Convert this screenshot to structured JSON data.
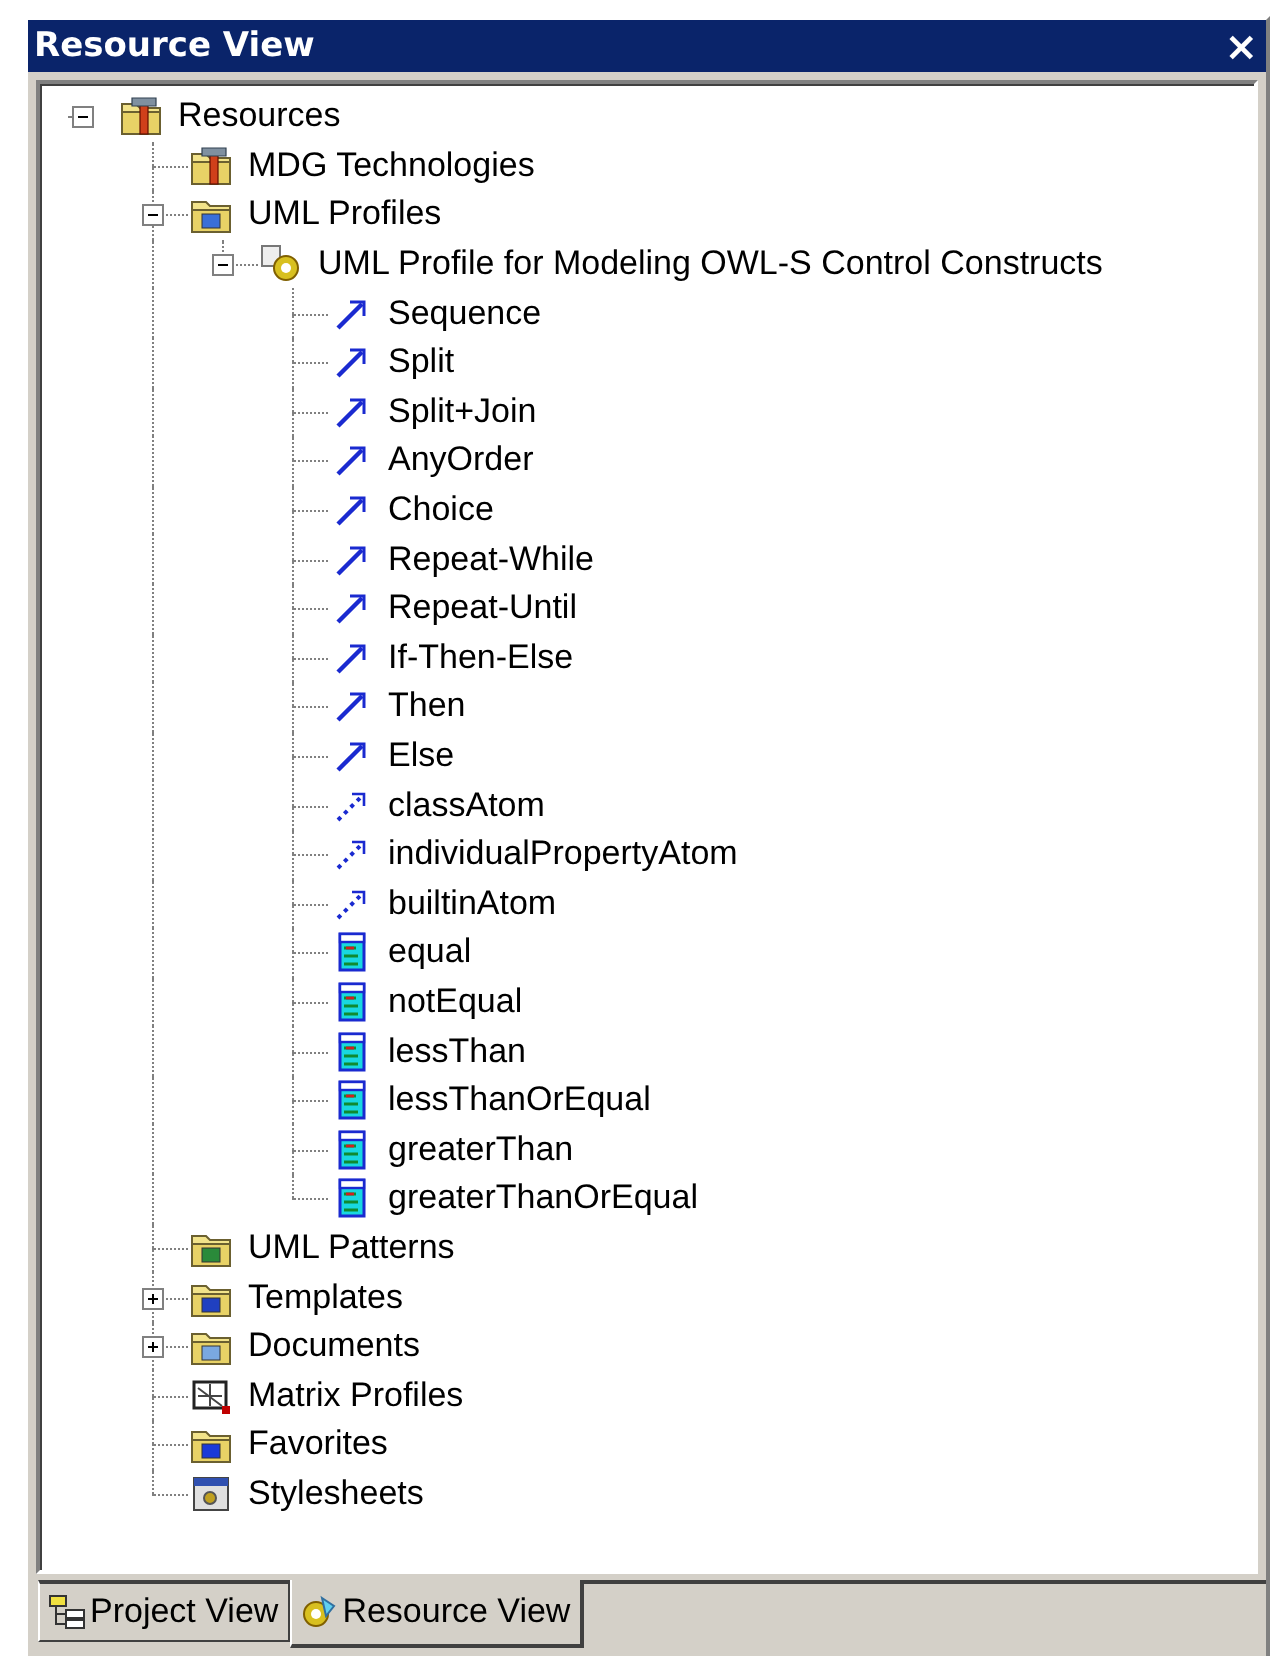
{
  "window": {
    "title": "Resource View",
    "close": "×"
  },
  "tree": [
    {
      "label": "Resources",
      "kind": "folder-tools",
      "expanded": true,
      "children": [
        {
          "label": "MDG Technologies",
          "kind": "folder-tools"
        },
        {
          "label": "UML Profiles",
          "kind": "folder-profiles",
          "expanded": true,
          "children": [
            {
              "label": "UML Profile for Modeling OWL-S Control Constructs",
              "kind": "profile",
              "expanded": true,
              "children": [
                {
                  "label": "Sequence",
                  "kind": "stereotype"
                },
                {
                  "label": "Split",
                  "kind": "stereotype"
                },
                {
                  "label": "Split+Join",
                  "kind": "stereotype"
                },
                {
                  "label": "AnyOrder",
                  "kind": "stereotype"
                },
                {
                  "label": "Choice",
                  "kind": "stereotype"
                },
                {
                  "label": "Repeat-While",
                  "kind": "stereotype"
                },
                {
                  "label": "Repeat-Until",
                  "kind": "stereotype"
                },
                {
                  "label": "If-Then-Else",
                  "kind": "stereotype"
                },
                {
                  "label": "Then",
                  "kind": "stereotype"
                },
                {
                  "label": "Else",
                  "kind": "stereotype"
                },
                {
                  "label": "classAtom",
                  "kind": "dependency"
                },
                {
                  "label": "individualPropertyAtom",
                  "kind": "dependency"
                },
                {
                  "label": "builtinAtom",
                  "kind": "dependency"
                },
                {
                  "label": "equal",
                  "kind": "table"
                },
                {
                  "label": "notEqual",
                  "kind": "table"
                },
                {
                  "label": "lessThan",
                  "kind": "table"
                },
                {
                  "label": "lessThanOrEqual",
                  "kind": "table"
                },
                {
                  "label": "greaterThan",
                  "kind": "table"
                },
                {
                  "label": "greaterThanOrEqual",
                  "kind": "table"
                }
              ]
            }
          ]
        },
        {
          "label": "UML Patterns",
          "kind": "folder-patterns"
        },
        {
          "label": "Templates",
          "kind": "folder-templates",
          "expanded": false
        },
        {
          "label": "Documents",
          "kind": "folder-documents",
          "expanded": false
        },
        {
          "label": "Matrix Profiles",
          "kind": "matrix"
        },
        {
          "label": "Favorites",
          "kind": "folder-favorites"
        },
        {
          "label": "Stylesheets",
          "kind": "stylesheet"
        }
      ]
    }
  ],
  "tabs": [
    {
      "label": "Project View",
      "kind": "project",
      "selected": false
    },
    {
      "label": "Resource View",
      "kind": "resource",
      "selected": true
    }
  ]
}
